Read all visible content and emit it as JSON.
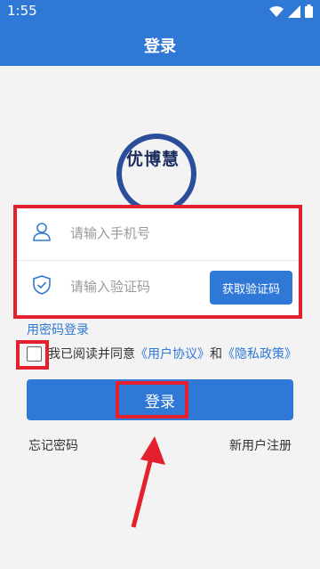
{
  "status_bar": {
    "time": "1:55",
    "icons": [
      "wifi-icon",
      "signal-icon",
      "battery-icon"
    ]
  },
  "app_bar": {
    "title": "登录"
  },
  "logo": {
    "text": "优博慧"
  },
  "form": {
    "phone_placeholder": "请输入手机号",
    "code_placeholder": "请输入验证码",
    "get_code_label": "获取验证码",
    "icons": [
      "user-icon",
      "shield-check-icon"
    ]
  },
  "password_login_link": "用密码登录",
  "agreement": {
    "prefix": "我已阅读并同意",
    "user_agreement": "《用户协议》",
    "and": "和",
    "privacy_policy": "《隐私政策》",
    "checked": false
  },
  "login_button": "登录",
  "footer": {
    "forgot_password": "忘记密码",
    "register": "新用户注册"
  },
  "colors": {
    "primary": "#2f78d6",
    "highlight": "#e5202e",
    "logo": "#2b4e9b"
  }
}
